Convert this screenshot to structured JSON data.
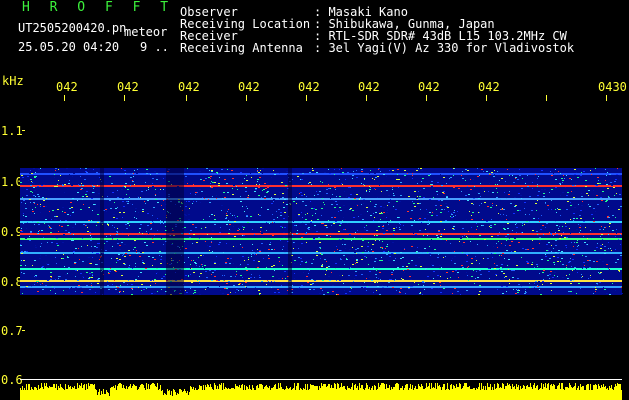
{
  "header": {
    "app_name": "H R O F F T",
    "filename": "UT2505200420.pn",
    "mode": "meteor",
    "datetime": "25.05.20 04:20",
    "count": "9 ..",
    "fields": [
      {
        "label": "Observer",
        "value": ": Masaki Kano"
      },
      {
        "label": "Receiving Location",
        "value": ": Shibukawa, Gunma, Japan"
      },
      {
        "label": "Receiver",
        "value": ": RTL-SDR SDR# 43dB L15 103.2MHz CW"
      },
      {
        "label": "Receiving Antenna",
        "value": ": 3el Yagi(V) Az 330 for Vladivostok"
      }
    ]
  },
  "axis": {
    "unit_label": "kHz",
    "y_ticks": [
      "1.1",
      "1.0",
      "0.9",
      "0.8",
      "0.7",
      "0.6"
    ],
    "time_labels": [
      "042",
      "042",
      "042",
      "042",
      "042",
      "042",
      "042",
      "042",
      "0430"
    ]
  },
  "colors": {
    "background": "#000000",
    "label_yellow": "#ffff33",
    "header_green": "#3cf23c",
    "spectrum_base": "#000a8c",
    "signal_red": "#ff2020",
    "amplitude_fill": "#ffff00"
  }
}
